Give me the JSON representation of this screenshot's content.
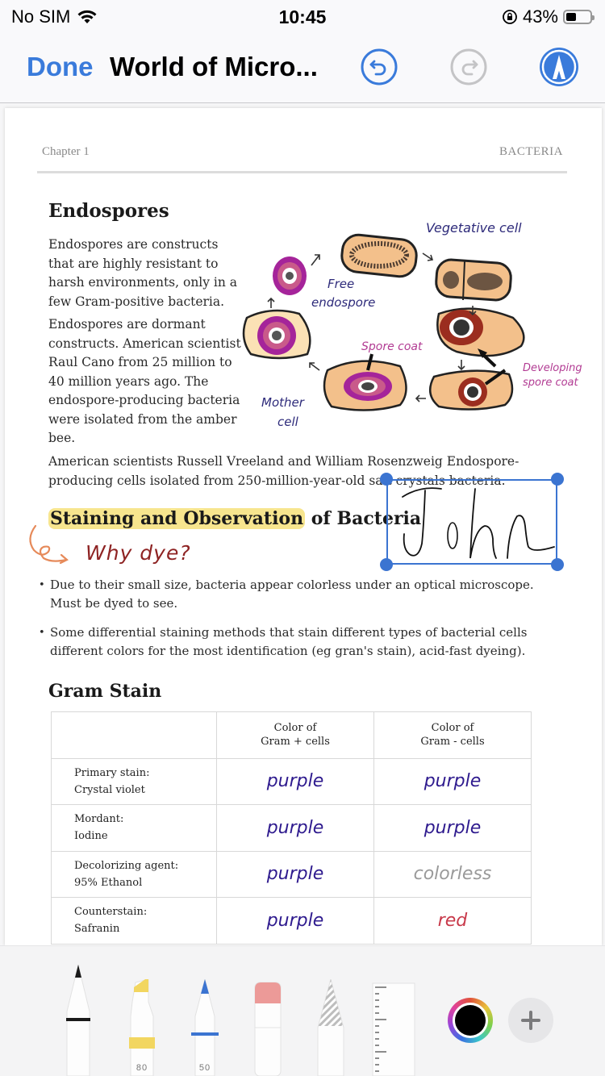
{
  "status_bar": {
    "carrier": "No SIM",
    "time": "10:45",
    "battery_percent": "43%",
    "battery_level": 0.43
  },
  "nav": {
    "done_label": "Done",
    "title": "World of Micro...",
    "icons": [
      "undo-icon",
      "redo-icon",
      "markup-icon"
    ]
  },
  "page": {
    "chapter": "Chapter 1",
    "section": "BACTERIA",
    "endospores": {
      "heading": "Endospores",
      "para1": "Endospores are constructs that are highly resistant to harsh environments, only in a few Gram-positive bacteria.",
      "para2": "Endospores are dormant constructs. American scientist Raul Cano from 25 million to 40 million years ago. The endospore-producing bacteria were isolated from the amber bee.",
      "para3": "American scientists Russell Vreeland and William Rosenzweig Endospore-producing cells isolated from 250-million-year-old salt crystals bacteria."
    },
    "diagram": {
      "labels": {
        "vegetative": "Vegetative cell",
        "free_line1": "Free",
        "free_line2": "endospore",
        "spore_coat": "Spore coat",
        "developing_line1": "Developing",
        "developing_line2": "spore coat",
        "mother_line1": "Mother",
        "mother_line2": "cell"
      }
    },
    "staining": {
      "heading_highlighted": "Staining and Observation",
      "heading_rest": " of Bacteria",
      "handwritten_note": "Why dye?",
      "bullets": [
        "Due to their small size, bacteria appear colorless under an optical microscope. Must be dyed to see.",
        "Some differential staining methods that stain different types of bacterial cells different colors for the most identification (eg gran's stain), acid-fast dyeing)."
      ]
    },
    "signature": {
      "text": "John"
    },
    "gram_stain": {
      "heading": "Gram Stain",
      "columns": [
        "",
        "Color of\nGram + cells",
        "Color of\nGram - cells"
      ],
      "rows": [
        {
          "label1": "Primary stain:",
          "label2": "Crystal violet",
          "pos": "purple",
          "neg": "purple"
        },
        {
          "label1": "Mordant:",
          "label2": "Iodine",
          "pos": "purple",
          "neg": "purple"
        },
        {
          "label1": "Decolorizing agent:",
          "label2": "95% Ethanol",
          "pos": "purple",
          "neg": "colorless"
        },
        {
          "label1": "Counterstain:",
          "label2": "Safranin",
          "pos": "purple",
          "neg": "red"
        }
      ]
    }
  },
  "tools": {
    "pen": {
      "name": "pen",
      "color": "#1a1a1a"
    },
    "highlighter": {
      "name": "highlighter",
      "color": "#f2d660",
      "opacity_label": "80"
    },
    "marker": {
      "name": "marker",
      "color": "#3b74d1",
      "opacity_label": "50"
    },
    "eraser": {
      "name": "eraser",
      "color": "#ec9a98"
    },
    "lasso": {
      "name": "lasso"
    },
    "ruler": {
      "name": "ruler"
    },
    "current_color": "#000000"
  },
  "colors": {
    "accent": "#3a7bdb",
    "purple_ink": "#2e1a8e",
    "colorless_ink": "#9a9a9a",
    "red_ink": "#c8394a",
    "highlight": "#f7e58e",
    "selection": "#3b74d1"
  }
}
